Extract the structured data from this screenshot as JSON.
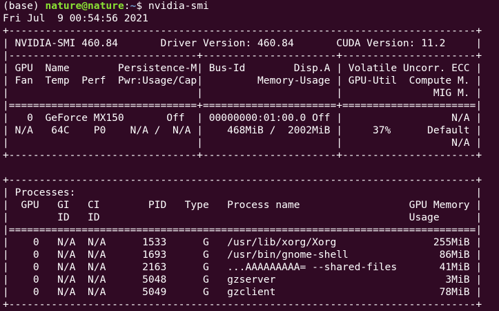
{
  "window": {
    "title": "nature@nature: ~"
  },
  "prompt": {
    "env": "(base) ",
    "user_host": "nature@nature",
    "colon": ":",
    "path": "~",
    "symbol": "$ ",
    "command": "nvidia-smi"
  },
  "output_lines": [
    "Fri Jul  9 00:54:56 2021",
    "+-----------------------------------------------------------------------------+",
    "| NVIDIA-SMI 460.84       Driver Version: 460.84       CUDA Version: 11.2     |",
    "|-------------------------------+----------------------+----------------------+",
    "| GPU  Name        Persistence-M| Bus-Id        Disp.A | Volatile Uncorr. ECC |",
    "| Fan  Temp  Perf  Pwr:Usage/Cap|         Memory-Usage | GPU-Util  Compute M. |",
    "|                               |                      |               MIG M. |",
    "|===============================+======================+======================|",
    "|   0  GeForce MX150       Off  | 00000000:01:00.0 Off |                  N/A |",
    "| N/A   64C    P0    N/A /  N/A |    468MiB /  2002MiB |     37%      Default |",
    "|                               |                      |                  N/A |",
    "+-------------------------------+----------------------+----------------------+",
    "",
    "+-----------------------------------------------------------------------------+",
    "| Processes:                                                                  |",
    "|  GPU   GI   CI        PID   Type   Process name                  GPU Memory |",
    "|        ID   ID                                                   Usage      |",
    "|=============================================================================|",
    "|    0   N/A  N/A      1533      G   /usr/lib/xorg/Xorg                255MiB |",
    "|    0   N/A  N/A      1693      G   /usr/bin/gnome-shell               86MiB |",
    "|    0   N/A  N/A      2163      G   ...AAAAAAAAA= --shared-files       41MiB |",
    "|    0   N/A  N/A      5048      G   gzserver                            3MiB |",
    "|    0   N/A  N/A      5049      G   gzclient                           78MiB |",
    "+-----------------------------------------------------------------------------+"
  ],
  "colors": {
    "background": "#300a24",
    "foreground": "#ffffff",
    "prompt_user": "#8ae234",
    "prompt_path": "#729fcf"
  }
}
